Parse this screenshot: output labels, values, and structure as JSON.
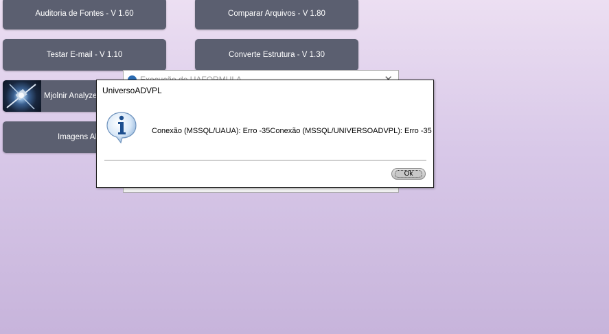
{
  "menu": {
    "auditoria": "Auditoria de Fontes - V 1.60",
    "comparar": "Comparar Arquivos - V 1.80",
    "testar_email": "Testar E-mail - V 1.10",
    "converte": "Converte Estrutura - V 1.30",
    "mjolnir": "Mjolnir Analyzer",
    "imagens": "Imagens APO -"
  },
  "background_window": {
    "title": "Execução de UAFORMULA"
  },
  "dialog": {
    "title": "UniversoADVPL",
    "message": "Conexão (MSSQL/UAUA): Erro  -35Conexão (MSSQL/UNIVERSOADVPL): Erro  -35",
    "ok_label": "Ok",
    "icon": "info-icon"
  },
  "colors": {
    "tile": "#5b5f70",
    "background_top": "#ecdff2",
    "background_bottom": "#c7b4db"
  }
}
